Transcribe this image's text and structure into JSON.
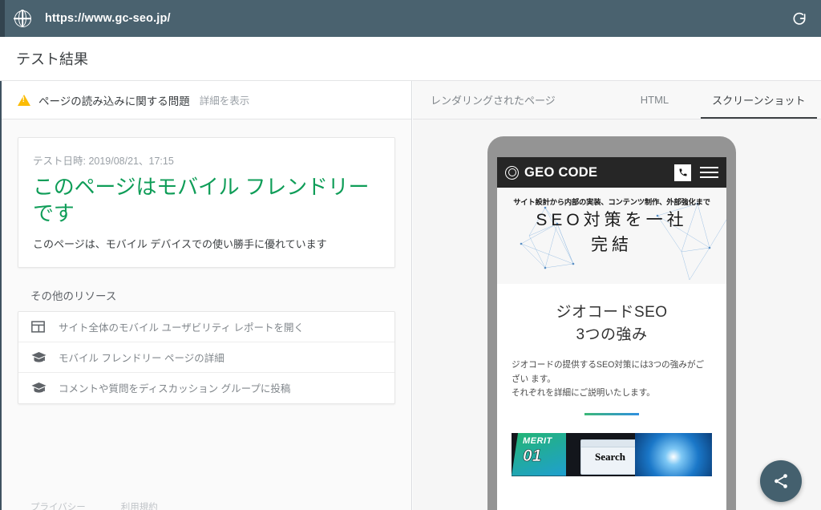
{
  "browser": {
    "url": "https://www.gc-seo.jp/",
    "globe_icon": "globe-icon",
    "reload_icon": "reload-icon"
  },
  "header": {
    "page_title": "テスト結果"
  },
  "warning": {
    "icon": "warning-triangle-icon",
    "text": "ページの読み込みに関する問題",
    "link": "詳細を表示"
  },
  "result_card": {
    "date_label": "テスト日時: 2019/08/21、17:15",
    "headline": "このページはモバイル フレンドリーです",
    "subtext": "このページは、モバイル デバイスでの使い勝手に優れています",
    "headline_color": "#0f9d58"
  },
  "resources": {
    "title": "その他のリソース",
    "items": [
      {
        "icon": "dashboard-report-icon",
        "label": "サイト全体のモバイル ユーザビリティ レポートを開く"
      },
      {
        "icon": "school-cap-icon",
        "label": "モバイル フレンドリー ページの詳細"
      },
      {
        "icon": "school-cap-icon",
        "label": "コメントや質問をディスカッション グループに投稿"
      }
    ]
  },
  "footer": {
    "links": [
      "プライバシー",
      "利用規約"
    ]
  },
  "tabs": [
    {
      "label": "レンダリングされたページ",
      "active": false
    },
    {
      "label": "HTML",
      "active": false
    },
    {
      "label": "スクリーンショット",
      "active": true
    }
  ],
  "phone_preview": {
    "site_header": {
      "brand": "GEO CODE",
      "logo_icon": "geocode-circle-logo-icon",
      "phone_icon": "phone-icon",
      "menu_icon": "hamburger-menu-icon"
    },
    "hero": {
      "kicker": "サイト設計から内部の実装、コンテンツ制作、外部強化まで",
      "title_line1": "SEO対策を一社",
      "title_line2": "完結"
    },
    "section": {
      "heading_line1": "ジオコードSEO",
      "heading_line2": "3つの強み",
      "paragraph_line1": "ジオコードの提供するSEO対策には3つの強みがござい",
      "paragraph_line2": "ます。",
      "paragraph_line3": "それぞれを詳細にご説明いたします。"
    },
    "merit_banner": {
      "label": "MERIT",
      "number": "01",
      "search_text": "Search"
    }
  },
  "fab": {
    "icon": "share-icon",
    "color": "#44606e"
  }
}
